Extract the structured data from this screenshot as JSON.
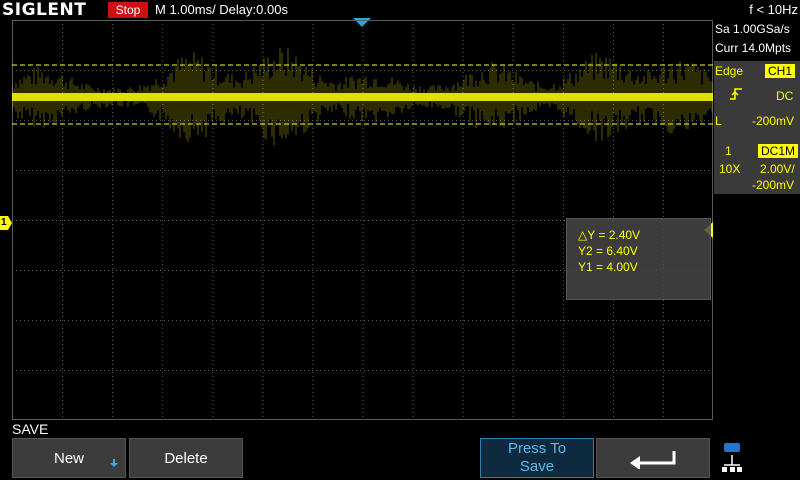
{
  "top_bar": {
    "logo": "SIGLENT",
    "run_status": "Stop",
    "timebase": "M 1.00ms/ Delay:0.00s",
    "trigger_freq": "f < 10Hz"
  },
  "acquisition": {
    "sample_rate": "Sa 1.00GSa/s",
    "memory_depth": "Curr 14.0Mpts"
  },
  "trigger": {
    "type": "Edge",
    "source": "CH1",
    "slope_icon": "rising-edge-icon",
    "coupling": "DC",
    "level_prefix": "L",
    "level": "-200mV"
  },
  "channel": {
    "number": "1",
    "coupling": "DC1M",
    "probe": "10X",
    "scale": "2.00V/",
    "offset": "-200mV",
    "marker_label": "1"
  },
  "cursor_readout": {
    "delta_y": "△Y = 2.40V",
    "y2": "Y2 = 6.40V",
    "y1": "Y1 = 4.00V"
  },
  "menu": {
    "title": "SAVE",
    "buttons": {
      "new_label": "New",
      "delete_label": "Delete",
      "press_to_save_line1": "Press To",
      "press_to_save_line2": "Save"
    },
    "return_icon": "return-arrow-icon",
    "status_icon": "usb-network-icon"
  },
  "colors": {
    "trace": "#ffff00",
    "channel_badge": "#ffff00",
    "run_status": "#d01010",
    "active_button": "#5fb8f0",
    "trigger_marker": "#2aa8e0"
  }
}
